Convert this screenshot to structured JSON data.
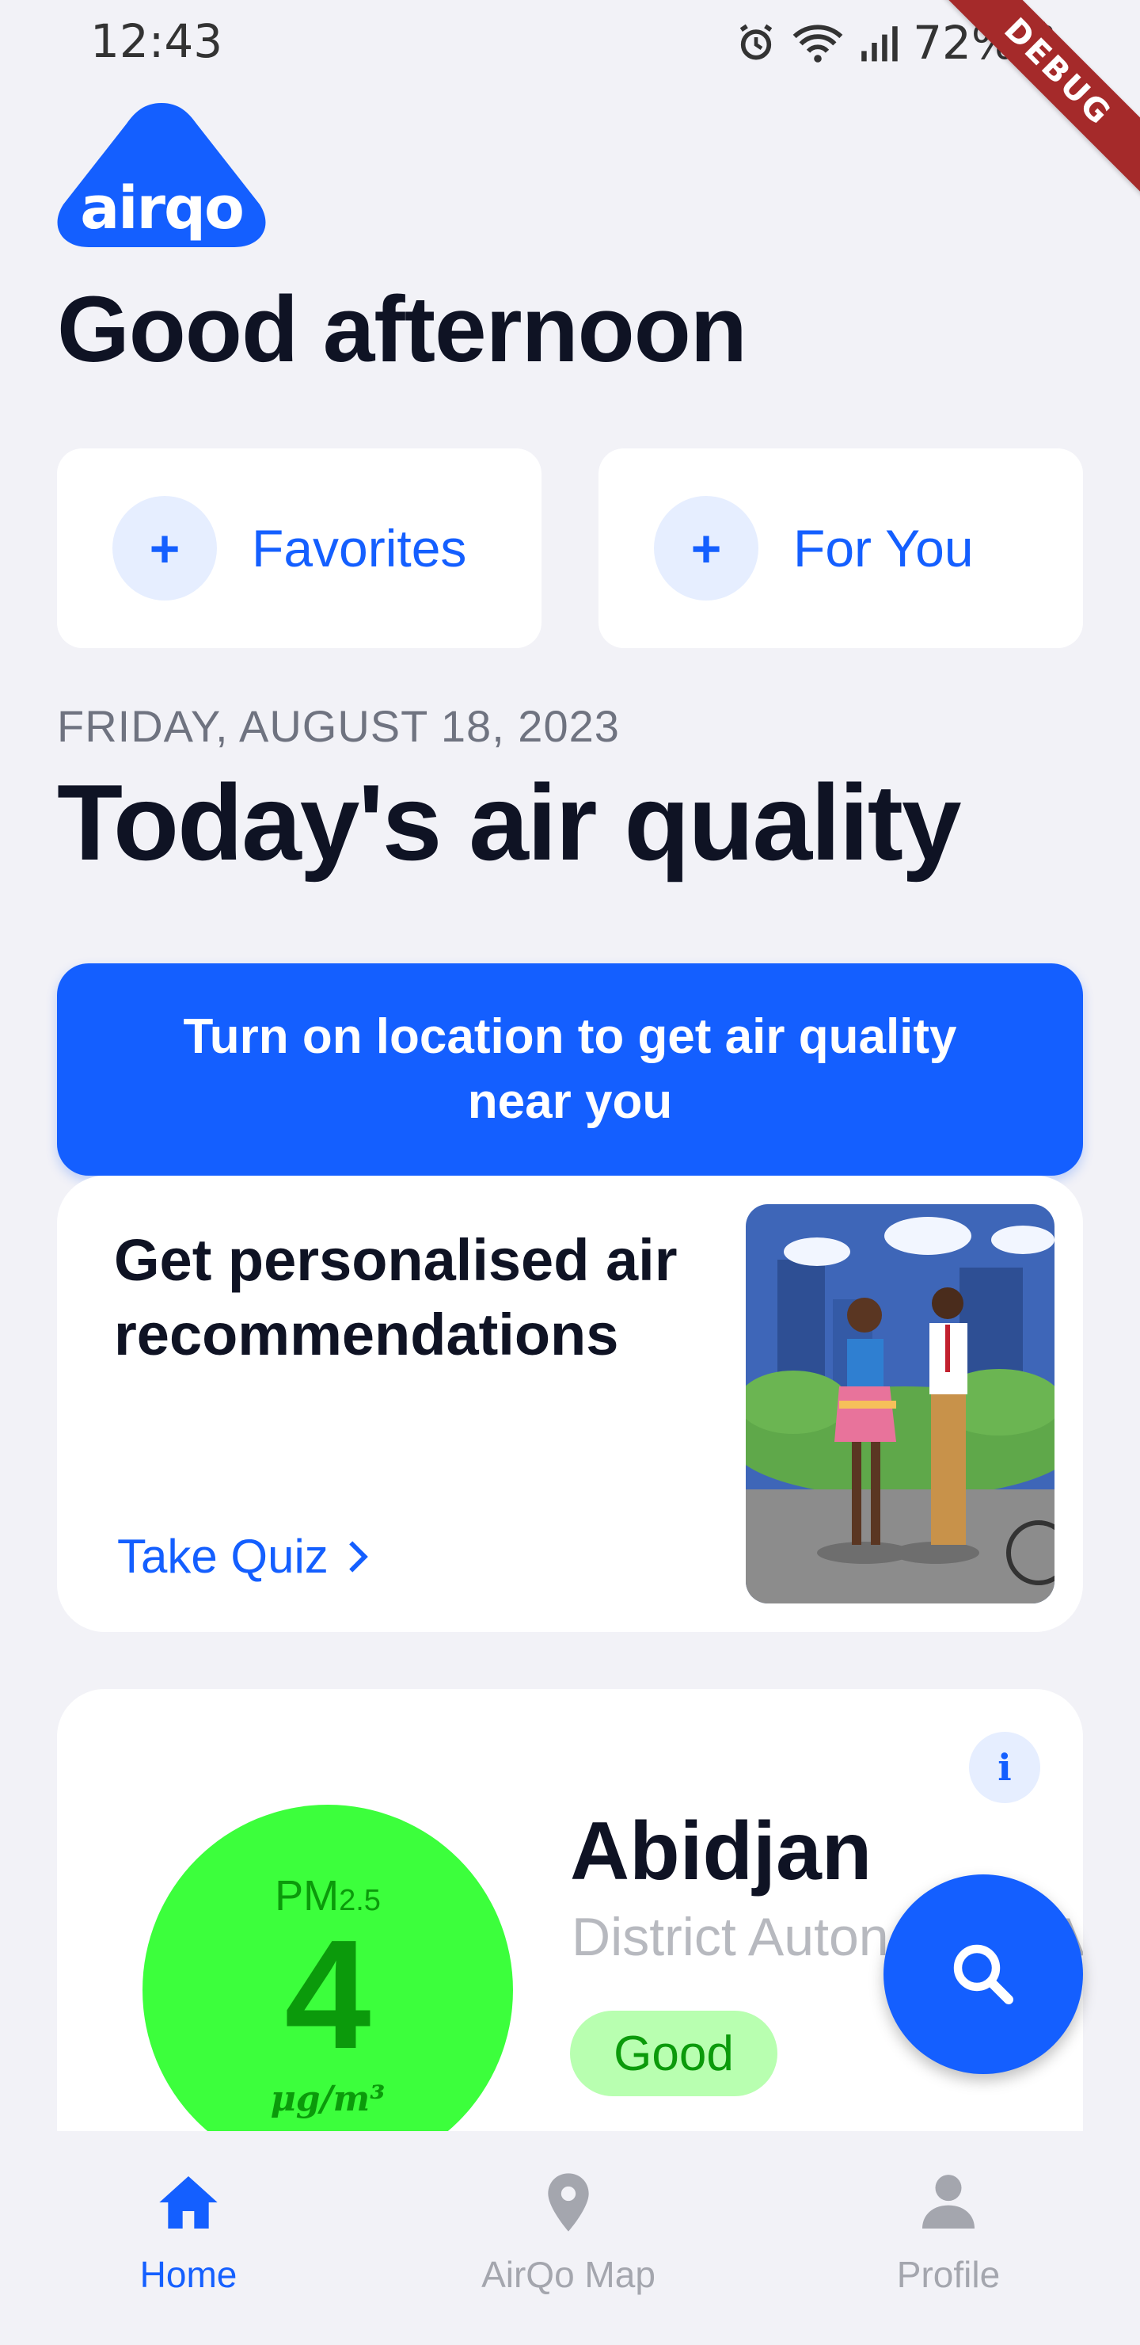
{
  "status_bar": {
    "time": "12:43",
    "battery": "72%",
    "debug_label": "DEBUG"
  },
  "logo": {
    "text": "airqo"
  },
  "greeting": "Good afternoon",
  "actions": [
    {
      "icon": "plus-icon",
      "label": "Favorites"
    },
    {
      "icon": "plus-icon",
      "label": "For You"
    }
  ],
  "date": "FRIDAY, AUGUST 18, 2023",
  "headline": "Today's air quality",
  "location_banner": "Turn on location to get air quality near you",
  "quiz_card": {
    "title": "Get personalised air recommendations",
    "link_label": "Take Quiz",
    "image": "people-outdoors-illustration"
  },
  "air_quality_card": {
    "pollutant": "PM",
    "pollutant_sub": "2.5",
    "value": "4",
    "unit": "μg/m³",
    "city": "Abidjan",
    "location": "District Autonome d'Abidjan",
    "category": "Good",
    "colors": {
      "circle": "#3CFF3C",
      "text": "#0B9A0B",
      "badge": "#B8FFB0"
    }
  },
  "bottom_nav": [
    {
      "icon": "home-icon",
      "label": "Home",
      "active": true
    },
    {
      "icon": "map-pin-icon",
      "label": "AirQo Map",
      "active": false
    },
    {
      "icon": "person-icon",
      "label": "Profile",
      "active": false
    }
  ],
  "colors": {
    "accent": "#145FFF",
    "background": "#F2F2F7"
  }
}
